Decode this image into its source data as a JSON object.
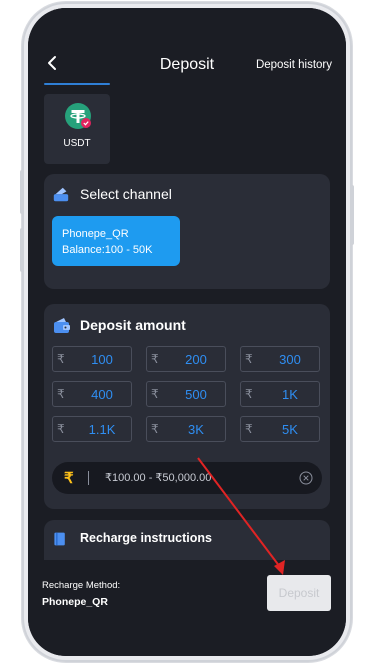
{
  "header": {
    "back_icon": "chevron-left-icon",
    "title": "Deposit",
    "history_label": "Deposit history"
  },
  "currency_tab": {
    "label": "USDT",
    "icon": "usdt-coin-icon"
  },
  "select_channel": {
    "title": "Select channel",
    "icon": "channel-icon",
    "channel": {
      "name": "Phonepe_QR",
      "balance": "Balance:100 - 50K"
    }
  },
  "deposit_amount": {
    "title": "Deposit amount",
    "icon": "wallet-icon",
    "currency_symbol": "₹",
    "amounts": [
      "100",
      "200",
      "300",
      "400",
      "500",
      "1K",
      "1.1K",
      "3K",
      "5K"
    ],
    "input": {
      "symbol": "₹",
      "placeholder": "₹100.00 - ₹50,000.00",
      "clear_icon": "close-circle-icon"
    }
  },
  "recharge_instructions": {
    "title": "Recharge instructions",
    "icon": "book-icon"
  },
  "bottom_bar": {
    "method_label": "Recharge Method:",
    "method_value": "Phonepe_QR",
    "deposit_button": "Deposit"
  },
  "colors": {
    "background": "#1b1d24",
    "card": "#2a2d37",
    "accent_blue": "#1e9bf0",
    "amount_text": "#2f8ef2",
    "rupee_yellow": "#ffc21a",
    "annotation_arrow": "#e02424"
  }
}
